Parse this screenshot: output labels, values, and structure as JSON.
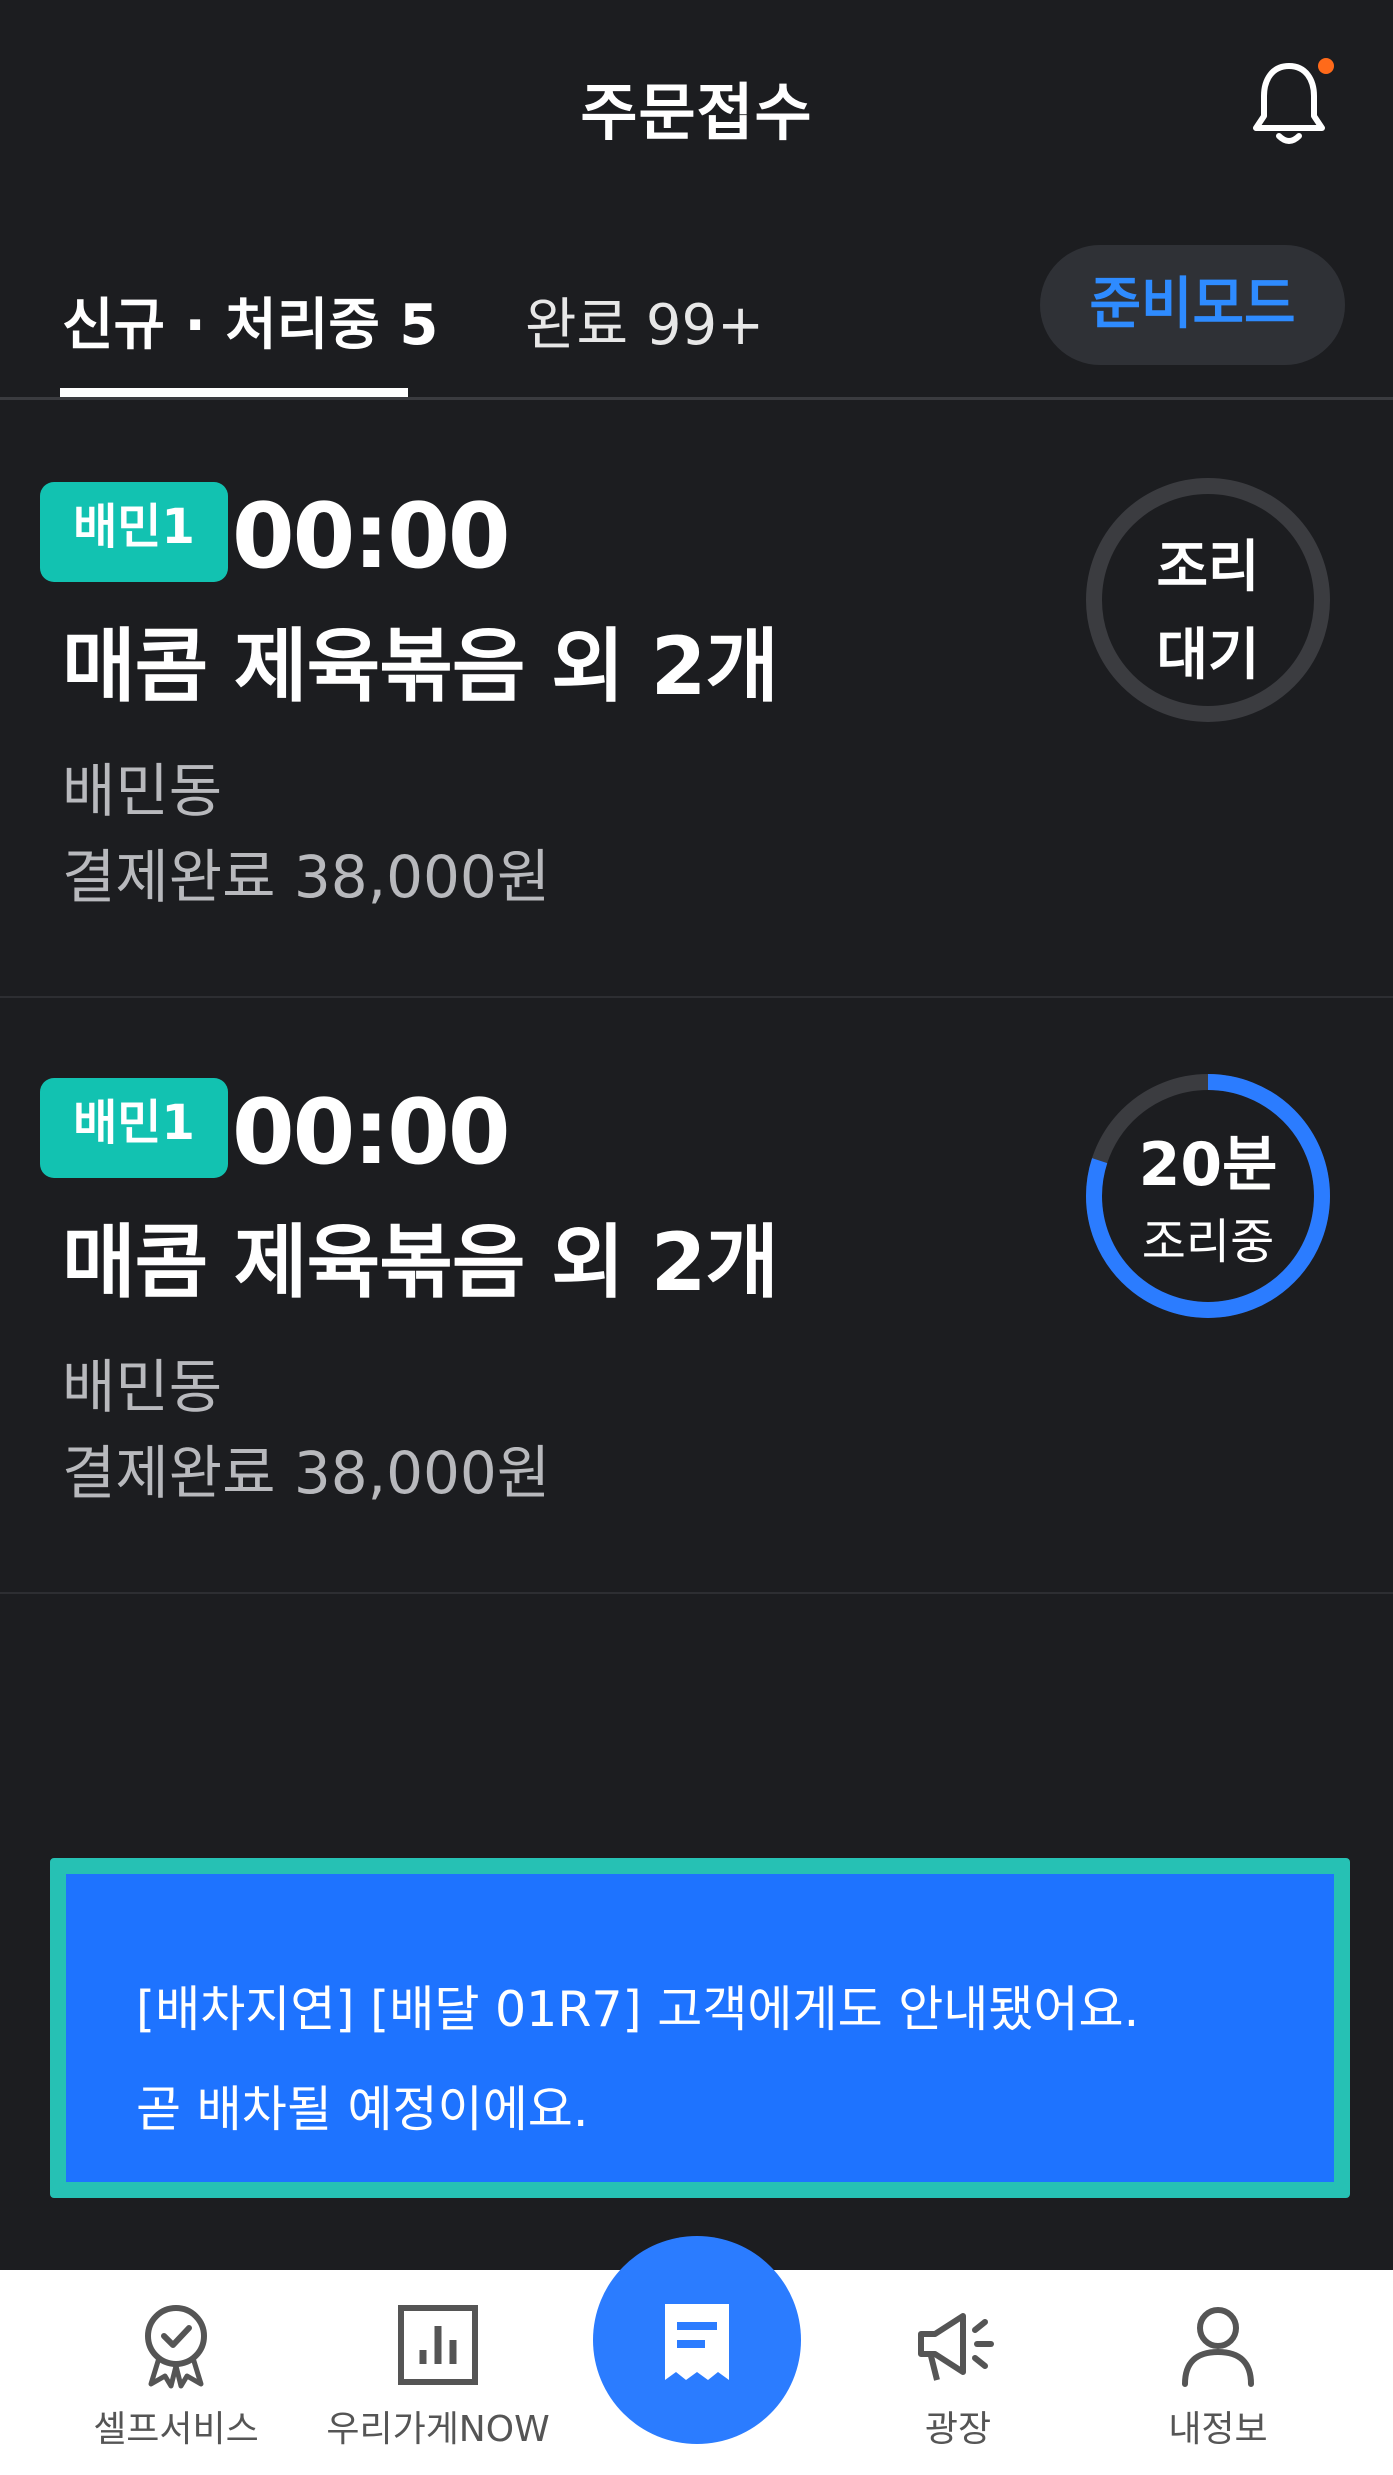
{
  "header": {
    "title": "주문접수",
    "notification_icon": "bell-icon",
    "notification_dot_color": "#ff6a1a"
  },
  "tabs": [
    {
      "label": "신규 · 처리중 5",
      "active": true
    },
    {
      "label": "완료 99+",
      "active": false
    }
  ],
  "mode_button": {
    "label": "준비모드",
    "color": "#2e8bff"
  },
  "orders": [
    {
      "platform_badge": "배민1",
      "time": "00:00",
      "menu": "매콤 제육볶음 외 2개",
      "address": "배민동",
      "payment": "결제완료 38,000원",
      "status_line1": "조리",
      "status_line2": "대기",
      "progress": 0
    },
    {
      "platform_badge": "배민1",
      "time": "00:00",
      "menu": "매콤 제육볶음 외 2개",
      "address": "배민동",
      "payment": "결제완료 38,000원",
      "status_line1": "20분",
      "status_line2": "조리중",
      "progress": 0.8
    }
  ],
  "toast": {
    "line1": "[배차지연] [배달 01R7] 고객에게도 안내됐어요.",
    "line2": "곧 배차될 예정이에요."
  },
  "bottom_nav": [
    {
      "label": "셀프서비스",
      "icon": "badge-check-icon"
    },
    {
      "label": "우리가게NOW",
      "icon": "bar-chart-icon"
    },
    {
      "label": "",
      "icon": "receipt-icon",
      "primary": true
    },
    {
      "label": "광장",
      "icon": "megaphone-icon"
    },
    {
      "label": "내정보",
      "icon": "person-icon"
    }
  ],
  "colors": {
    "background": "#1c1d20",
    "badge": "#12c2b1",
    "accent_blue": "#1e73ff",
    "toast_border": "#26c1b4"
  }
}
